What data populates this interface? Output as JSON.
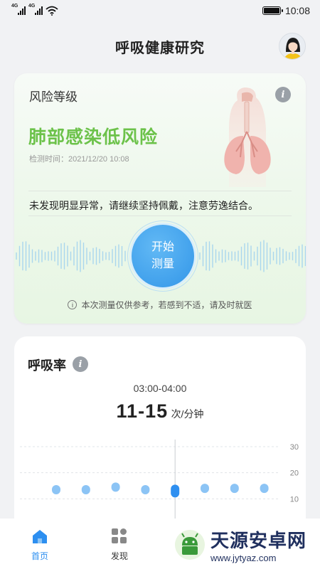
{
  "status_bar": {
    "network_1": "4G",
    "network_2": "4G",
    "time": "10:08"
  },
  "header": {
    "title": "呼吸健康研究"
  },
  "risk_card": {
    "title": "风险等级",
    "level": "肺部感染低风险",
    "level_color": "#6cc24a",
    "check_time": "检测时间：2021/12/20 10:08",
    "advice": "未发现明显异常，请继续坚持佩戴，注意劳逸结合。",
    "measure_button": {
      "line1": "开始",
      "line2": "测量"
    },
    "disclaimer": "本次测量仅供参考，若感到不适，请及时就医"
  },
  "rate_card": {
    "title": "呼吸率",
    "time_range": "03:00-04:00",
    "value": "11-15",
    "unit": "次/分钟"
  },
  "chart_data": {
    "type": "scatter",
    "y_ticks": [
      "30",
      "20",
      "10"
    ],
    "ylim": [
      0,
      30
    ],
    "points": [
      {
        "x": 1,
        "y": 13.5
      },
      {
        "x": 2,
        "y": 13.5
      },
      {
        "x": 3,
        "y": 14.5
      },
      {
        "x": 4,
        "y": 13.5
      },
      {
        "x": 5,
        "y": 13,
        "selected": true
      },
      {
        "x": 6,
        "y": 14
      },
      {
        "x": 7,
        "y": 14
      },
      {
        "x": 8,
        "y": 14
      }
    ],
    "point_color": "#8cc4f5",
    "selected_color": "#2e8ff0"
  },
  "tab_bar": {
    "tabs": [
      {
        "label": "首页",
        "icon": "home-icon",
        "active": true
      },
      {
        "label": "发现",
        "icon": "discover-icon",
        "active": false
      }
    ]
  },
  "watermark": {
    "name": "天源安卓网",
    "url": "www.jytyaz.com"
  }
}
